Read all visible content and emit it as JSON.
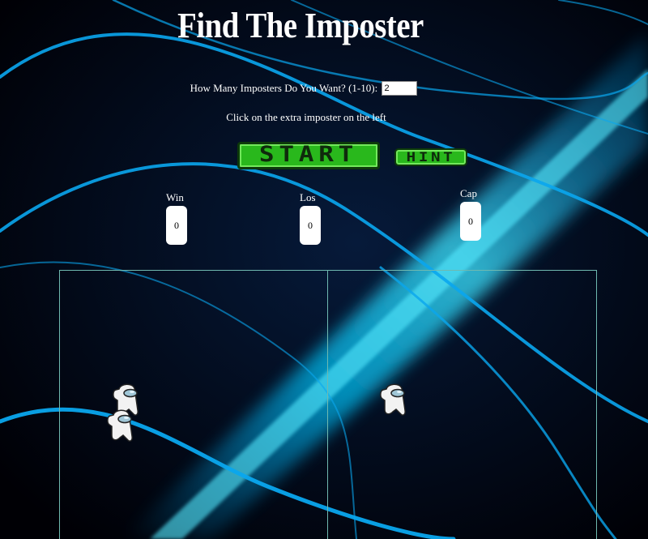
{
  "header": {
    "title": "Find The Imposter"
  },
  "settings": {
    "prompt_label": "How Many Imposters Do You Want? (1-10):",
    "imposter_count": "2",
    "instruction": "Click on the extra imposter on the left"
  },
  "controls": {
    "start_label": "START",
    "hint_label": "HINT"
  },
  "stats": {
    "win": {
      "label": "Win",
      "value": "0"
    },
    "loss": {
      "label": "Los",
      "value": "0"
    },
    "cap": {
      "label": "Cap",
      "value": "0"
    }
  },
  "game": {
    "left_panel_count": 2,
    "right_panel_count": 1,
    "character": "crewmate-icon"
  },
  "colors": {
    "background": "#000000",
    "streak": "#00c8ff",
    "button_green": "#29b81c",
    "panel_border": "#6fb9b0"
  }
}
